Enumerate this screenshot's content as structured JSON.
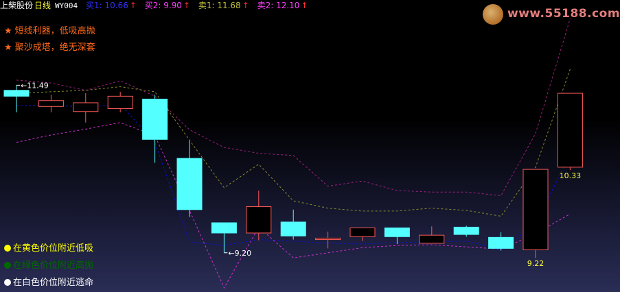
{
  "header": {
    "stock_name": "上柴股份",
    "period": "日线",
    "indicator": "WY004",
    "buy1": "买1: 10.66",
    "buy2": "买2: 9.90",
    "sell1": "卖1: 11.68",
    "sell2": "卖2: 12.10",
    "up_arrow": "↑"
  },
  "notes": [
    "短线利器，低吸高抛",
    "聚沙成塔，绝无深套"
  ],
  "note_star": "★",
  "legend": [
    {
      "text": "在黄色价位附近低吸",
      "color": "#ffff00"
    },
    {
      "text": "在绿色价位附近高抛",
      "color": "#006a00"
    },
    {
      "text": "在白色价位附近逃命",
      "color": "#ffffff"
    }
  ],
  "logo": {
    "url_text": "www.55188.com"
  },
  "colors": {
    "up": "#ff5a5a",
    "down": "#54ffff",
    "blue_line": "#1010d0",
    "magenta_line": "#d030d0",
    "purple_line": "#a02080",
    "olive_line": "#8a8a30",
    "yellow_label": "#ffff40"
  },
  "chart_data": {
    "type": "candlestick",
    "ylim": [
      8.72,
      12.43
    ],
    "candles": [
      {
        "o": 11.42,
        "c": 11.34,
        "h": 11.49,
        "l": 11.12
      },
      {
        "o": 11.2,
        "c": 11.28,
        "h": 11.36,
        "l": 11.12
      },
      {
        "o": 11.13,
        "c": 11.25,
        "h": 11.38,
        "l": 10.98
      },
      {
        "o": 11.17,
        "c": 11.34,
        "h": 11.4,
        "l": 11.12
      },
      {
        "o": 11.3,
        "c": 10.75,
        "h": 11.36,
        "l": 10.43
      },
      {
        "o": 10.49,
        "c": 9.79,
        "h": 10.73,
        "l": 9.69
      },
      {
        "o": 9.61,
        "c": 9.47,
        "h": 9.61,
        "l": 9.2
      },
      {
        "o": 9.47,
        "c": 9.83,
        "h": 10.05,
        "l": 9.37
      },
      {
        "o": 9.62,
        "c": 9.43,
        "h": 9.79,
        "l": 9.38
      },
      {
        "o": 9.38,
        "c": 9.4,
        "h": 9.49,
        "l": 9.26
      },
      {
        "o": 9.42,
        "c": 9.54,
        "h": 9.54,
        "l": 9.36
      },
      {
        "o": 9.54,
        "c": 9.42,
        "h": 9.54,
        "l": 9.32
      },
      {
        "o": 9.33,
        "c": 9.44,
        "h": 9.56,
        "l": 9.33
      },
      {
        "o": 9.55,
        "c": 9.45,
        "h": 9.57,
        "l": 9.42
      },
      {
        "o": 9.41,
        "c": 9.26,
        "h": 9.48,
        "l": 9.23
      },
      {
        "o": 9.24,
        "c": 10.34,
        "h": 10.34,
        "l": 9.13
      },
      {
        "o": 10.37,
        "c": 11.38,
        "h": 11.38,
        "l": 10.33
      }
    ],
    "lines": {
      "blue": [
        11.21,
        11.22,
        11.19,
        11.23,
        10.71,
        9.35,
        9.3,
        9.38,
        9.36,
        9.33,
        9.32,
        9.34,
        9.35,
        9.36,
        9.24,
        9.59,
        10.55
      ],
      "magenta_low": [
        10.71,
        10.81,
        10.89,
        10.98,
        10.8,
        9.78,
        8.72,
        9.55,
        9.13,
        9.2,
        9.27,
        9.3,
        9.31,
        9.28,
        9.25,
        9.46,
        9.73
      ],
      "purple_high": [
        11.56,
        11.52,
        11.42,
        11.55,
        11.34,
        10.88,
        10.64,
        10.56,
        10.53,
        10.11,
        10.18,
        10.05,
        10.03,
        10.03,
        9.98,
        10.83,
        12.4
      ],
      "olive_mid": [
        11.38,
        11.4,
        11.42,
        11.47,
        11.4,
        10.74,
        10.09,
        10.41,
        9.91,
        9.81,
        9.77,
        9.77,
        9.81,
        9.78,
        9.7,
        10.37,
        11.71
      ]
    },
    "annotations": [
      {
        "text": "11.49",
        "candle": 0,
        "value": 11.49,
        "color": "#ffffff",
        "style": "leader"
      },
      {
        "text": "9.20",
        "candle": 6,
        "value": 9.2,
        "color": "#ffffff",
        "style": "leader"
      },
      {
        "text": "9.22",
        "candle": 15,
        "value": 9.13,
        "color": "#ffff40",
        "style": "below"
      },
      {
        "text": "10.33",
        "candle": 16,
        "value": 10.33,
        "color": "#ffff40",
        "style": "below"
      }
    ]
  }
}
